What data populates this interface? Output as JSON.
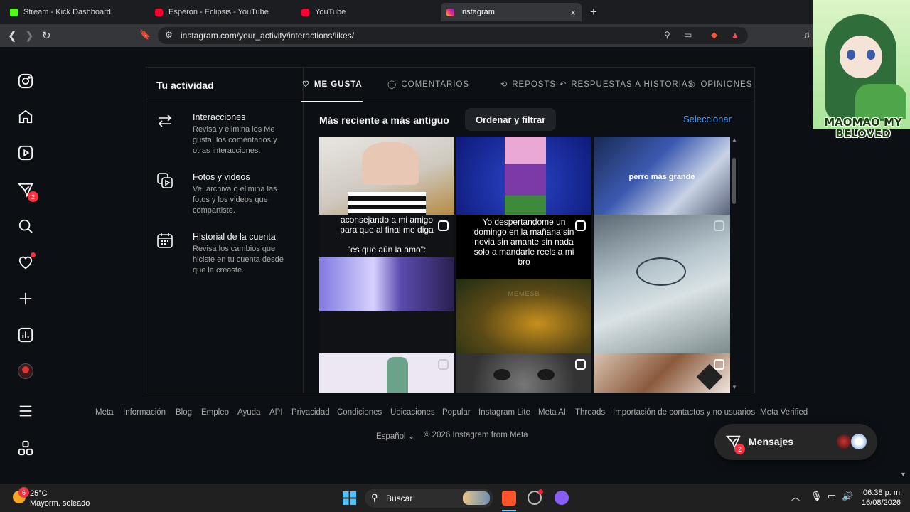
{
  "browser": {
    "tabs": [
      {
        "title": "Stream - Kick Dashboard",
        "color": "#53fc18"
      },
      {
        "title": "Esperón - Eclipsis - YouTube",
        "color": "#ff0033"
      },
      {
        "title": "YouTube",
        "color": "#ff0033"
      },
      {
        "title": "Instagram",
        "color": "#e1306c"
      }
    ],
    "new_tab": "+",
    "close": "×",
    "url": "instagram.com/your_activity/interactions/likes/"
  },
  "sidebar": {
    "notification_count": "2",
    "items": [
      "instagram-logo",
      "home",
      "reels",
      "messages",
      "search",
      "notifications",
      "create",
      "dashboard",
      "profile",
      "more",
      "also-from-meta"
    ]
  },
  "activity": {
    "title": "Tu actividad",
    "items": [
      {
        "title": "Interacciones",
        "desc": "Revisa y elimina los Me gusta, los comentarios y otras interacciones."
      },
      {
        "title": "Fotos y videos",
        "desc": "Ve, archiva o elimina las fotos y los videos que compartiste."
      },
      {
        "title": "Historial de la cuenta",
        "desc": "Revisa los cambios que hiciste en tu cuenta desde que la creaste."
      }
    ],
    "tabs": [
      "ME GUSTA",
      "COMENTARIOS",
      "REPOSTS",
      "RESPUESTAS A HISTORIAS",
      "OPINIONES"
    ],
    "sort_label": "Más reciente a más antiguo",
    "sort_button": "Ordenar y filtrar",
    "select_button": "Seleccionar",
    "captions": {
      "c3": "perro más grande",
      "c4": "aconsejando a mi amigo para que al final me diga",
      "c4b": "\"es que aún la amo\":",
      "c5": "Yo despertandome un domingo en la mañana sin novia sin amante sin nada solo a mandarle reels a mi bro",
      "wm": "MEMESB"
    }
  },
  "footer": {
    "links": [
      "Meta",
      "Información",
      "Blog",
      "Empleo",
      "Ayuda",
      "API",
      "Privacidad",
      "Condiciones",
      "Ubicaciones",
      "Popular",
      "Instagram Lite",
      "Meta AI",
      "Threads",
      "Importación de contactos y no usuarios",
      "Meta Verified"
    ],
    "language": "Español",
    "copyright": "© 2026 Instagram from Meta"
  },
  "messages": {
    "label": "Mensajes",
    "count": "2"
  },
  "overlay": {
    "watermark": "MAOMAO MY BELOVED"
  },
  "taskbar": {
    "temp": "25°C",
    "weather": "Mayorm. soleado",
    "weather_badge": "6",
    "search": "Buscar",
    "time": "06:38 p. m.",
    "date": "16/08/2026"
  }
}
